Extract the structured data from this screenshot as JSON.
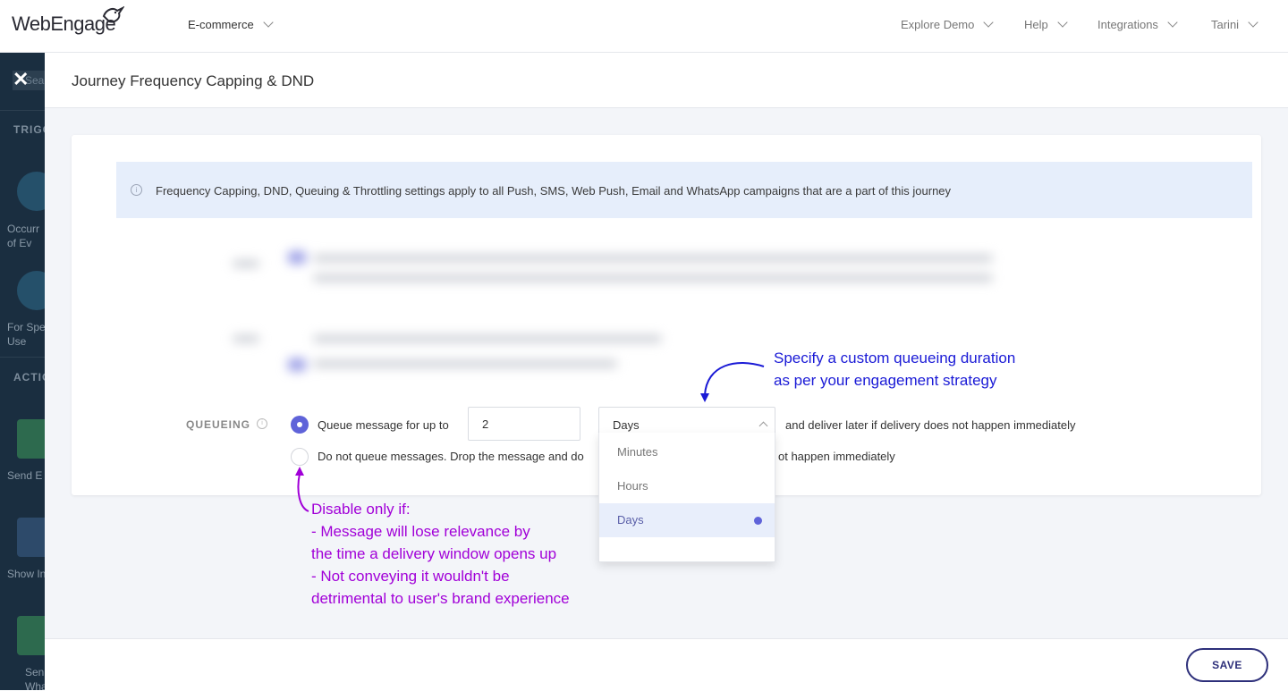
{
  "topbar": {
    "logo_text": "WebEngage",
    "project": "E-commerce",
    "nav": [
      "Explore Demo",
      "Help",
      "Integrations",
      "Tarini"
    ]
  },
  "sidebar": {
    "search_partial": "Sea",
    "section_trigger": "TRIGG",
    "section_actions": "ACTIO",
    "items": [
      {
        "label": "Occurr\nof Ev",
        "icon": "star-icon"
      },
      {
        "label": "For Spe\nUse",
        "icon": "csv-icon"
      },
      {
        "label": "Send E",
        "icon": "email-icon"
      },
      {
        "label": "Show In",
        "icon": "in-app-icon"
      },
      {
        "label": "Sen\nWhats",
        "icon": "whatsapp-icon"
      }
    ]
  },
  "modal": {
    "title": "Journey Frequency Capping & DND",
    "info": "Frequency Capping, DND, Queuing & Throttling settings apply to all Push, SMS, Web Push, Email and WhatsApp campaigns that are a part of this journey",
    "queueing": {
      "label": "QUEUEING",
      "option1_prefix": "Queue message for up to",
      "quantity": "2",
      "unit": "Days",
      "option1_suffix": "and deliver later if delivery does not happen immediately",
      "option2_start": "Do not queue messages. Drop the message and do",
      "option2_end": "ot happen immediately",
      "selected": "option1"
    },
    "dropdown_options": [
      "Minutes",
      "Hours",
      "Days"
    ],
    "dropdown_selected": "Days",
    "save_label": "SAVE"
  },
  "annotations": {
    "blue": [
      "Specify a custom queueing duration",
      "as per your engagement strategy"
    ],
    "purple": [
      "Disable only if:",
      "- Message will lose relevance by",
      "the time a delivery window opens up",
      "- Not conveying it wouldn't be",
      "detrimental to user's brand experience"
    ]
  },
  "colors": {
    "accent": "#5f63d9",
    "save_border": "#2d2f7a",
    "annotation_blue": "#1a1ad6",
    "annotation_purple": "#a100d8",
    "sidebar_bg": "#1a2e40"
  }
}
